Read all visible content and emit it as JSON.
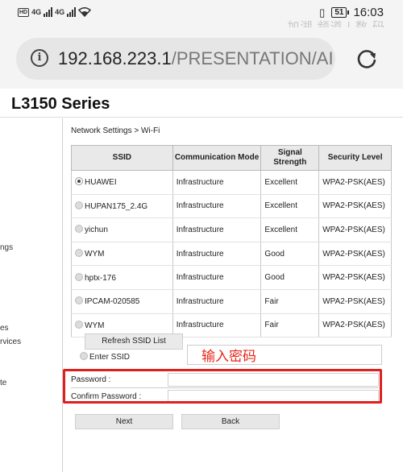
{
  "status_bar": {
    "left_badge": "HD",
    "net1": "4G",
    "net2": "4G",
    "battery": "51",
    "time": "16:03",
    "watermark": "加湖 频道 | 数 码"
  },
  "browser": {
    "url_host": "192.168.223.1",
    "url_path": "/PRESENTATION/AI",
    "info_icon": "i"
  },
  "page": {
    "product_title": "L3150 Series",
    "breadcrumb": "Network Settings > Wi-Fi"
  },
  "sidebar": {
    "items": [
      "ngs",
      "es",
      "rvices",
      "te"
    ]
  },
  "ssid_table": {
    "headers": [
      "SSID",
      "Communication Mode",
      "Signal Strength",
      "Security Level"
    ],
    "rows": [
      {
        "ssid": "HUAWEI",
        "mode": "Infrastructure",
        "signal": "Excellent",
        "security": "WPA2-PSK(AES)",
        "selected": true
      },
      {
        "ssid": "HUPAN175_2.4G",
        "mode": "Infrastructure",
        "signal": "Excellent",
        "security": "WPA2-PSK(AES)",
        "selected": false
      },
      {
        "ssid": "yichun",
        "mode": "Infrastructure",
        "signal": "Excellent",
        "security": "WPA2-PSK(AES)",
        "selected": false
      },
      {
        "ssid": "WYM",
        "mode": "Infrastructure",
        "signal": "Good",
        "security": "WPA2-PSK(AES)",
        "selected": false
      },
      {
        "ssid": "hptx-176",
        "mode": "Infrastructure",
        "signal": "Good",
        "security": "WPA2-PSK(AES)",
        "selected": false
      },
      {
        "ssid": "IPCAM-020585",
        "mode": "Infrastructure",
        "signal": "Fair",
        "security": "WPA2-PSK(AES)",
        "selected": false
      },
      {
        "ssid": "WYM",
        "mode": "Infrastructure",
        "signal": "Fair",
        "security": "WPA2-PSK(AES)",
        "selected": false
      }
    ]
  },
  "form": {
    "refresh_label": "Refresh SSID List",
    "enter_ssid_label": "Enter SSID",
    "annotation": "输入密码",
    "password_label": "Password :",
    "confirm_label": "Confirm Password :",
    "next_label": "Next",
    "back_label": "Back"
  },
  "colors": {
    "annotation_red": "#e01f1f",
    "header_gray": "#e9e9e9"
  }
}
